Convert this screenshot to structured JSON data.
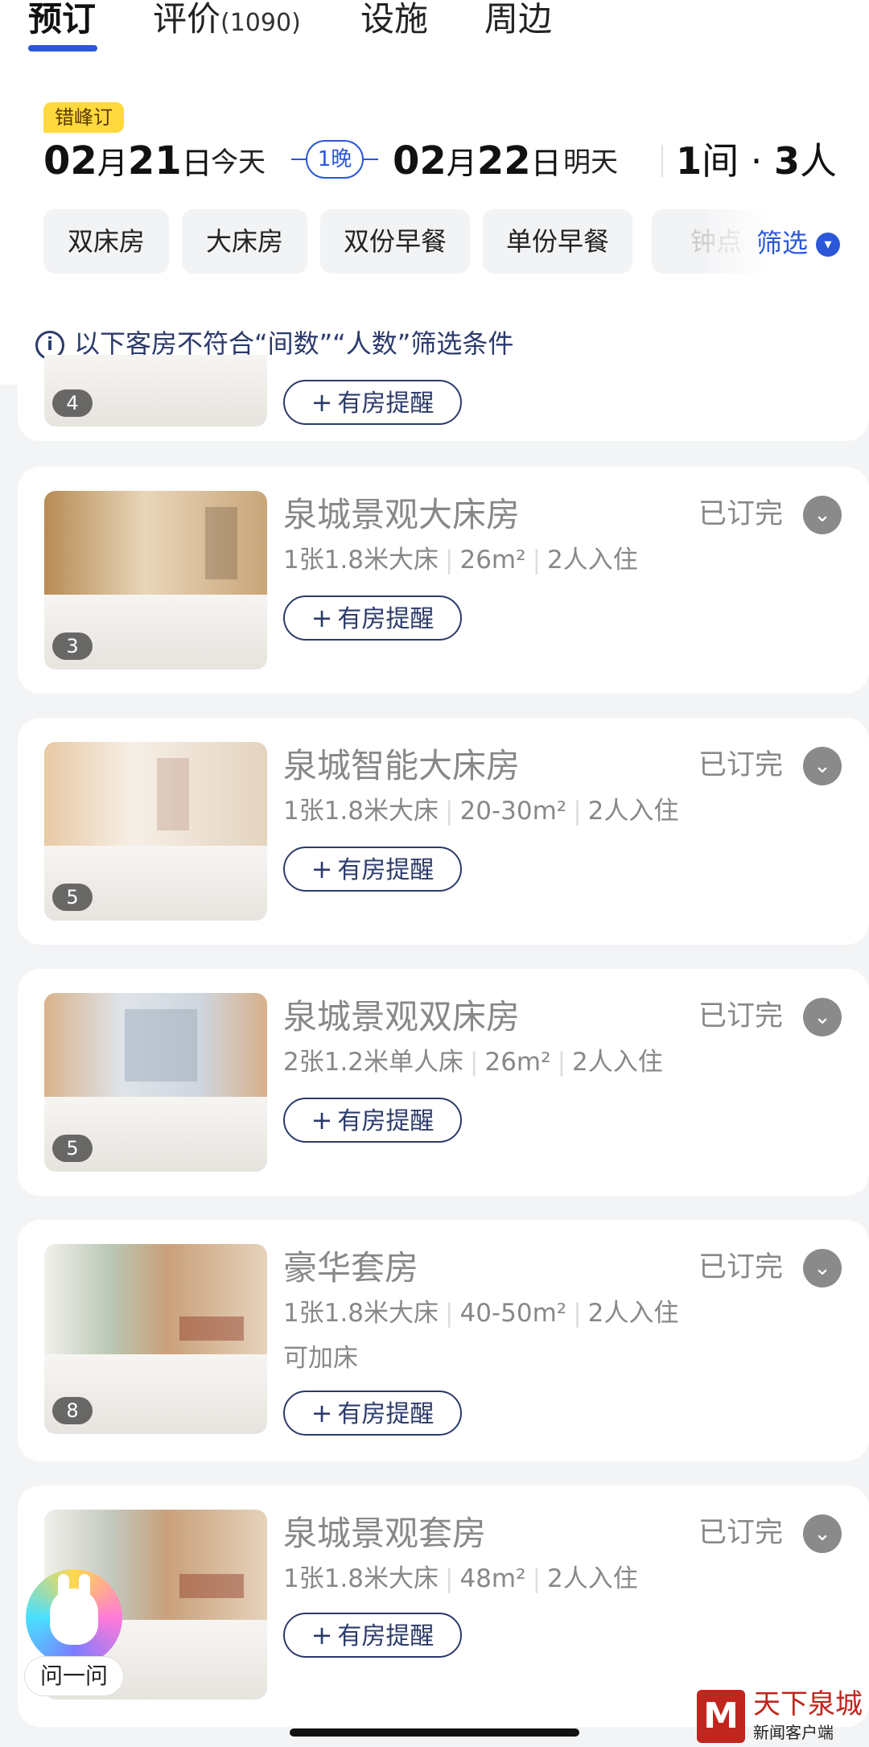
{
  "tabs": [
    {
      "label": "预订",
      "count": ""
    },
    {
      "label": "评价",
      "count": "(1090)"
    },
    {
      "label": "设施",
      "count": ""
    },
    {
      "label": "周边",
      "count": ""
    }
  ],
  "offpeak_badge": "错峰订",
  "checkin": {
    "month": "02",
    "day": "21",
    "month_unit": "月",
    "day_unit": "日",
    "sub": "今天"
  },
  "nights": "1晚",
  "checkout": {
    "month": "02",
    "day": "22",
    "month_unit": "月",
    "day_unit": "日",
    "sub": "明天"
  },
  "guests": {
    "rooms": "1",
    "rooms_unit": "间",
    "dot": " · ",
    "people": "3",
    "people_unit": "人"
  },
  "chips": [
    "双床房",
    "大床房",
    "双份早餐",
    "单份早餐",
    "钟点"
  ],
  "filter_label": "筛选",
  "notice": "以下客房不符合“间数”“人数”筛选条件",
  "remind_label": "有房提醒",
  "status_label": "已订完",
  "partial_card": {
    "photo_count": "4"
  },
  "rooms": [
    {
      "name": "泉城景观大床房",
      "bed": "1张1.8米大床",
      "area": "26m²",
      "occupancy": "2人入住",
      "extra": "",
      "photo_count": "3"
    },
    {
      "name": "泉城智能大床房",
      "bed": "1张1.8米大床",
      "area": "20-30m²",
      "occupancy": "2人入住",
      "extra": "",
      "photo_count": "5"
    },
    {
      "name": "泉城景观双床房",
      "bed": "2张1.2米单人床",
      "area": "26m²",
      "occupancy": "2人入住",
      "extra": "",
      "photo_count": "5"
    },
    {
      "name": "豪华套房",
      "bed": "1张1.8米大床",
      "area": "40-50m²",
      "occupancy": "2人入住",
      "extra": "可加床",
      "photo_count": "8"
    },
    {
      "name": "泉城景观套房",
      "bed": "1张1.8米大床",
      "area": "48m²",
      "occupancy": "2人入住",
      "extra": "",
      "photo_count": ""
    }
  ],
  "ask_label": "问一问",
  "watermark": {
    "mark": "M",
    "title": "天下泉城",
    "subtitle": "新闻客户端"
  },
  "colors": {
    "accent": "#2b58d8",
    "navy": "#2b3a6b",
    "badge": "#ffd93d",
    "brand_red": "#c0261e"
  }
}
